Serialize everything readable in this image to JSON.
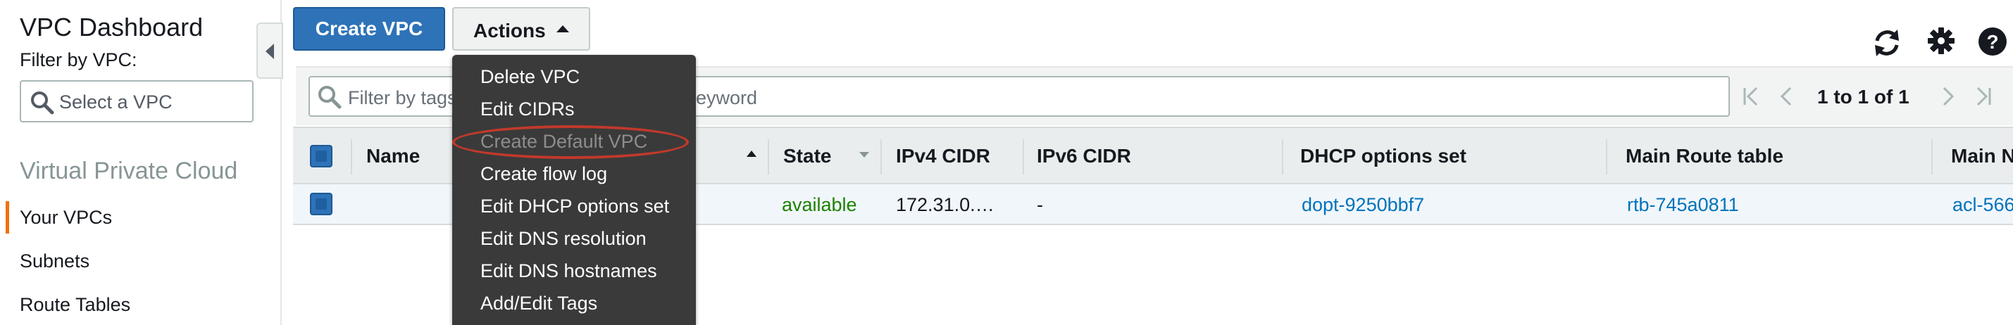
{
  "sidebar": {
    "title": "VPC Dashboard",
    "filter_label": "Filter by VPC:",
    "select_placeholder": "Select a VPC",
    "section_title": "Virtual Private Cloud",
    "items": [
      {
        "label": "Your VPCs",
        "active": true
      },
      {
        "label": "Subnets"
      },
      {
        "label": "Route Tables"
      }
    ],
    "accent_color": "#ec7211"
  },
  "toolbar": {
    "create_label": "Create VPC",
    "actions_label": "Actions",
    "icons": [
      "refresh-icon",
      "gear-icon",
      "help-icon"
    ]
  },
  "filter": {
    "placeholder_left": "Filter by tags",
    "placeholder_right": "eyword",
    "pager_text": "1 to 1 of 1"
  },
  "table": {
    "headers": [
      "Name",
      "State",
      "IPv4 CIDR",
      "IPv6 CIDR",
      "DHCP options set",
      "Main Route table",
      "Main N"
    ],
    "rows": [
      {
        "state": "available",
        "ipv4": "172.31.0.…",
        "ipv6": "-",
        "dhcp": "dopt-9250bbf7",
        "route_table": "rtb-745a0811",
        "main_acl": "acl-566"
      }
    ]
  },
  "actions_menu": {
    "items": [
      {
        "label": "Delete VPC",
        "disabled": false
      },
      {
        "label": "Edit CIDRs",
        "disabled": false
      },
      {
        "label": "Create Default VPC",
        "disabled": true
      },
      {
        "label": "Create flow log",
        "disabled": false
      },
      {
        "label": "Edit DHCP options set",
        "disabled": false
      },
      {
        "label": "Edit DNS resolution",
        "disabled": false
      },
      {
        "label": "Edit DNS hostnames",
        "disabled": false
      },
      {
        "label": "Add/Edit Tags",
        "disabled": false
      }
    ]
  },
  "colors": {
    "primary": "#2e73b8",
    "link": "#0073bb",
    "status_ok": "#1d8102",
    "menu_bg": "#3a3a3a",
    "annotation": "#c1392b"
  }
}
